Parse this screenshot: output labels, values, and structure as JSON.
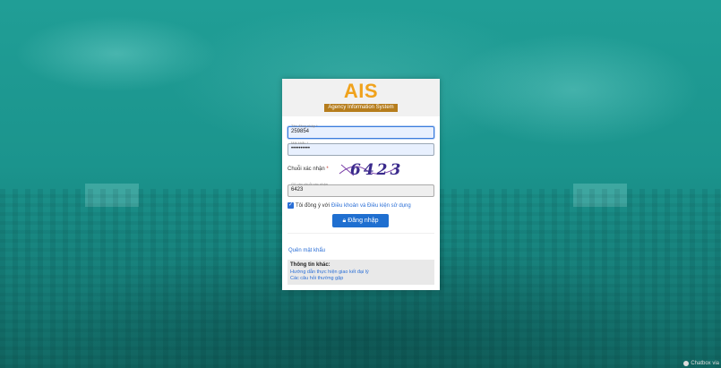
{
  "brand": {
    "logo": "AIS",
    "tagline": "Agency Information System"
  },
  "form": {
    "username": {
      "label": "Tên đăng nhập *",
      "value": "259854"
    },
    "password": {
      "label": "Mật khẩu *",
      "value": "••••••••••"
    },
    "captcha": {
      "label": "Chuỗi xác nhận",
      "required": "*",
      "image_text": "6423"
    },
    "captcha_input": {
      "label": "Gõ vào chuỗi xác nhận",
      "value": "6423"
    },
    "agree": {
      "text": "Tôi đồng ý với",
      "link": "Điều khoản và Điều kiện sử dụng",
      "checked": true
    },
    "submit_label": "Đăng nhập"
  },
  "links": {
    "forgot": "Quên mật khẩu"
  },
  "info": {
    "title": "Thông tin khác:",
    "items": [
      "Hướng dẫn thực hiện giao kết đại lý",
      "Các câu hỏi thường gặp"
    ]
  },
  "chat": {
    "label": "Chatbox via"
  },
  "colors": {
    "brand_orange": "#f0a21c",
    "primary_blue": "#1f6fd0",
    "background_teal": "#1f9a93"
  }
}
